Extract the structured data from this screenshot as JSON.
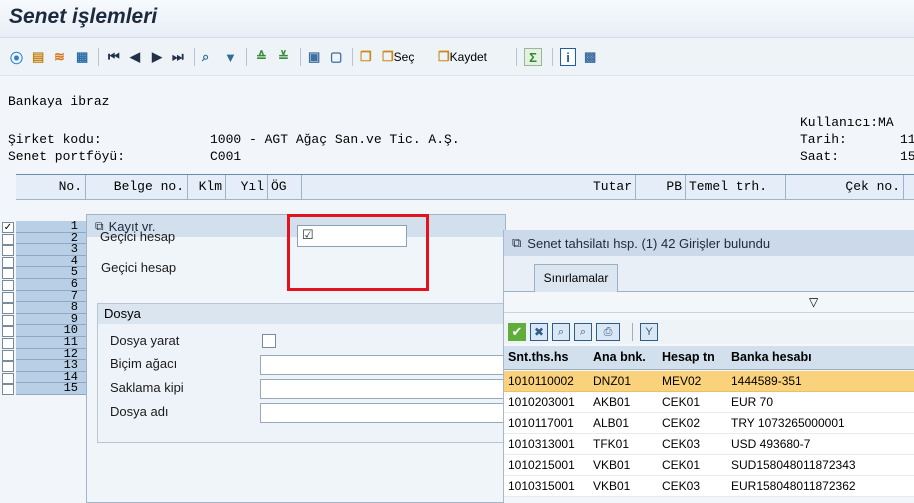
{
  "title": "Senet işlemleri",
  "toolbar": {
    "sec_label": "Seç",
    "kaydet_label": "Kaydet"
  },
  "header": {
    "subtitle": "Bankaya ibraz",
    "company_label": "Şirket kodu:",
    "company_value": "1000 - AGT Ağaç San.ve Tic. A.Ş.",
    "portfolio_label": "Senet portföyü:",
    "portfolio_value": "C001",
    "user_label": "Kullanıcı:MA",
    "date_label": "Tarih:",
    "date_value": "11",
    "time_label": "Saat:",
    "time_value": "15"
  },
  "grid": {
    "columns": [
      "No.",
      "Belge no.",
      "Klm",
      "Yıl",
      "ÖG",
      "Tutar",
      "PB",
      "Temel trh.",
      "Çek no."
    ],
    "row_numbers": [
      "1",
      "2",
      "3",
      "4",
      "5",
      "6",
      "7",
      "8",
      "9",
      "10",
      "11",
      "12",
      "13",
      "14",
      "15"
    ],
    "row1_checked": "✓"
  },
  "dialog_kayit": {
    "title": "Kayıt vr.",
    "gecici_label": "Geçici hesap",
    "gecici_checkmark": "☑",
    "group_title": "Dosya",
    "dosya_yarat_label": "Dosya yarat",
    "bicim_label": "Biçim ağacı",
    "saklama_label": "Saklama kipi",
    "dosya_adi_label": "Dosya adı"
  },
  "dialog_search": {
    "title": "Senet tahsilatı hsp. (1)   42 Girişler bulundu",
    "tab_label": "Sınırlamalar",
    "columns": [
      "Snt.ths.hs",
      "Ana bnk.",
      "Hesap tn",
      "Banka hesabı"
    ],
    "rows": [
      [
        "1010110002",
        "DNZ01",
        "MEV02",
        "1444589-351"
      ],
      [
        "1010203001",
        "AKB01",
        "CEK01",
        "EUR 70"
      ],
      [
        "1010117001",
        "ALB01",
        "CEK02",
        "TRY 1073265000001"
      ],
      [
        "1010313001",
        "TFK01",
        "CEK03",
        "USD 493680-7"
      ],
      [
        "1010215001",
        "VKB01",
        "CEK01",
        "SUD158048011872343"
      ],
      [
        "1010315001",
        "VKB01",
        "CEK03",
        "EUR158048011872362"
      ]
    ]
  },
  "colors": {
    "selected_row": "#fbd27c",
    "highlight_box": "#e3121c"
  }
}
